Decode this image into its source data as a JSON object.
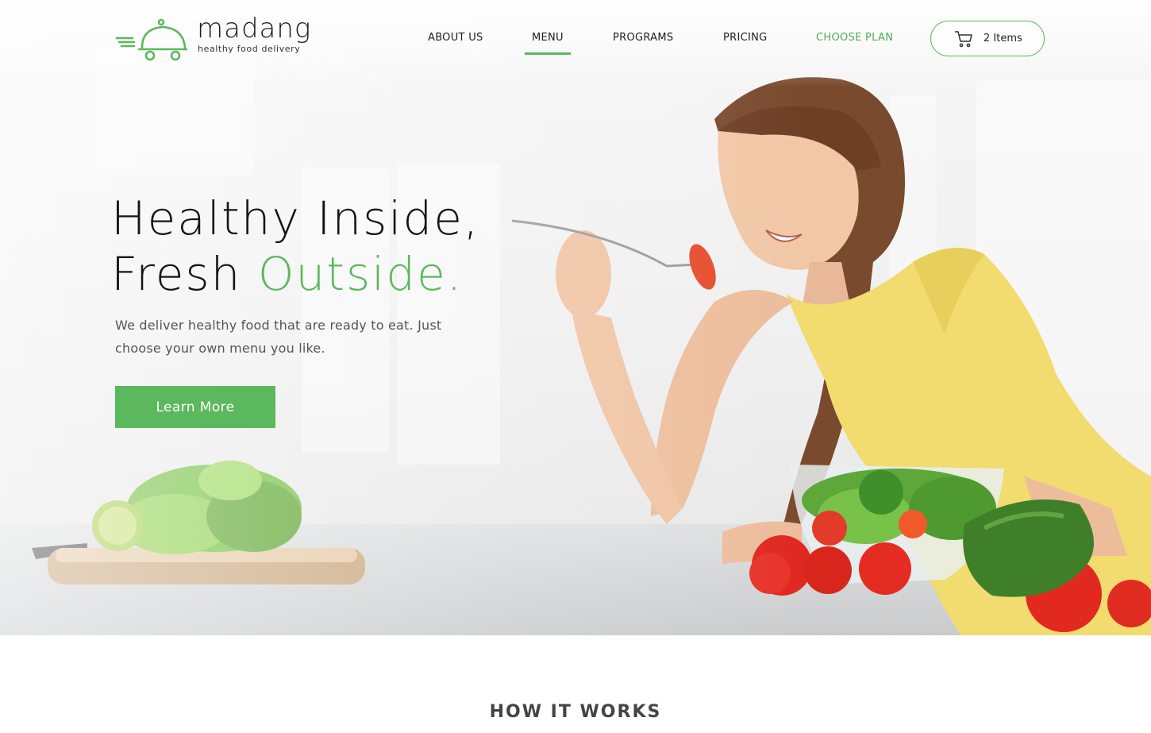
{
  "brand": {
    "name": "madang",
    "tagline": "healthy food delivery",
    "accent_color": "#5cb85c"
  },
  "nav": {
    "items": [
      {
        "label": "ABOUT US",
        "active": false
      },
      {
        "label": "MENU",
        "active": true
      },
      {
        "label": "PROGRAMS",
        "active": false
      },
      {
        "label": "PRICING",
        "active": false
      },
      {
        "label": "CHOOSE PLAN",
        "active": false,
        "highlighted": true
      }
    ]
  },
  "cart": {
    "icon": "cart-icon",
    "label": "2 Items"
  },
  "hero": {
    "headline_line1": "Healthy Inside,",
    "headline_line2_prefix": "Fresh ",
    "headline_line2_accent": "Outside.",
    "subtext": "We deliver healthy food that are ready to eat. Just choose your own menu you like.",
    "cta_label": "Learn More",
    "image_description_icon": "woman-eating-salad-image"
  },
  "section": {
    "title": "HOW IT WORKS"
  }
}
